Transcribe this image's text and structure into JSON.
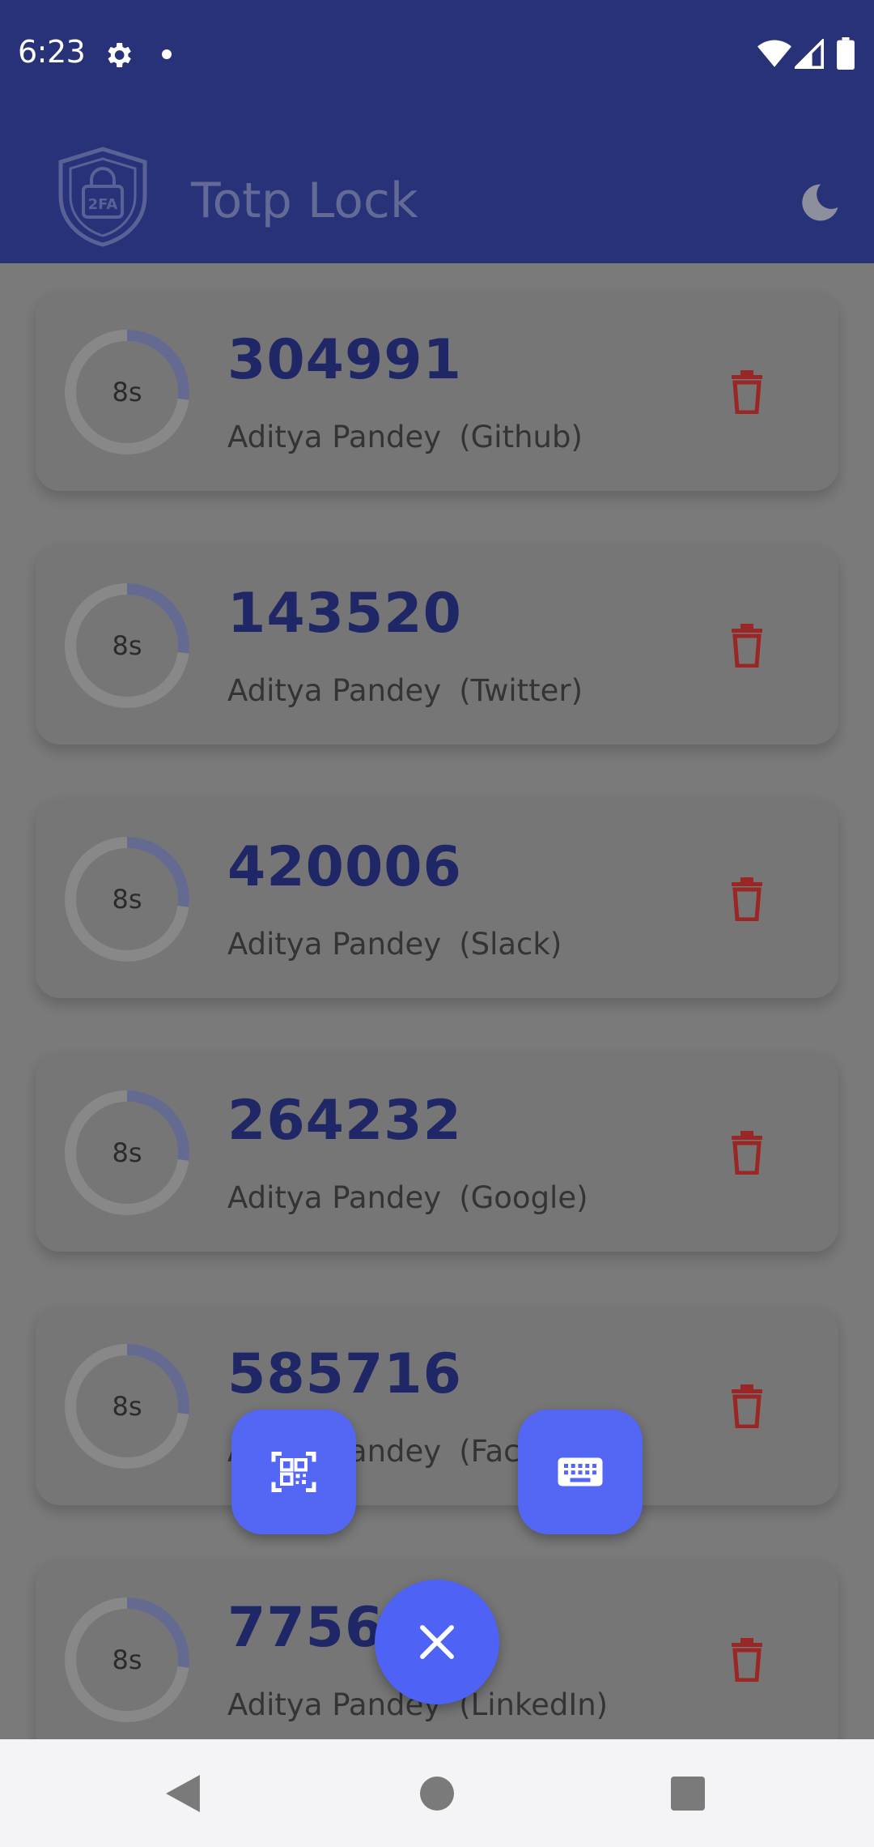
{
  "status_bar": {
    "time": "6:23"
  },
  "app_bar": {
    "title": "Totp Lock",
    "logo_text": "2FA"
  },
  "entries": [
    {
      "code": "304991",
      "name": "Aditya Pandey",
      "service": "(Github)",
      "timer": "8s",
      "progress": 0.27
    },
    {
      "code": "143520",
      "name": "Aditya Pandey",
      "service": "(Twitter)",
      "timer": "8s",
      "progress": 0.27
    },
    {
      "code": "420006",
      "name": "Aditya Pandey",
      "service": "(Slack)",
      "timer": "8s",
      "progress": 0.27
    },
    {
      "code": "264232",
      "name": "Aditya Pandey",
      "service": "(Google)",
      "timer": "8s",
      "progress": 0.27
    },
    {
      "code": "585716",
      "name": "Aditya Pandey",
      "service": "(Facebook)",
      "timer": "8s",
      "progress": 0.27
    },
    {
      "code": "775640",
      "name": "Aditya Pandey",
      "service": "(LinkedIn)",
      "timer": "8s",
      "progress": 0.27
    }
  ],
  "fabs": {
    "scan_qr_icon": "qr-scan-icon",
    "manual_entry_icon": "keyboard-icon",
    "close_icon": "close-icon"
  },
  "colors": {
    "primary": "#283279",
    "fab": "#5366f4",
    "delete": "#9a2626",
    "code_text": "#1f2767"
  }
}
